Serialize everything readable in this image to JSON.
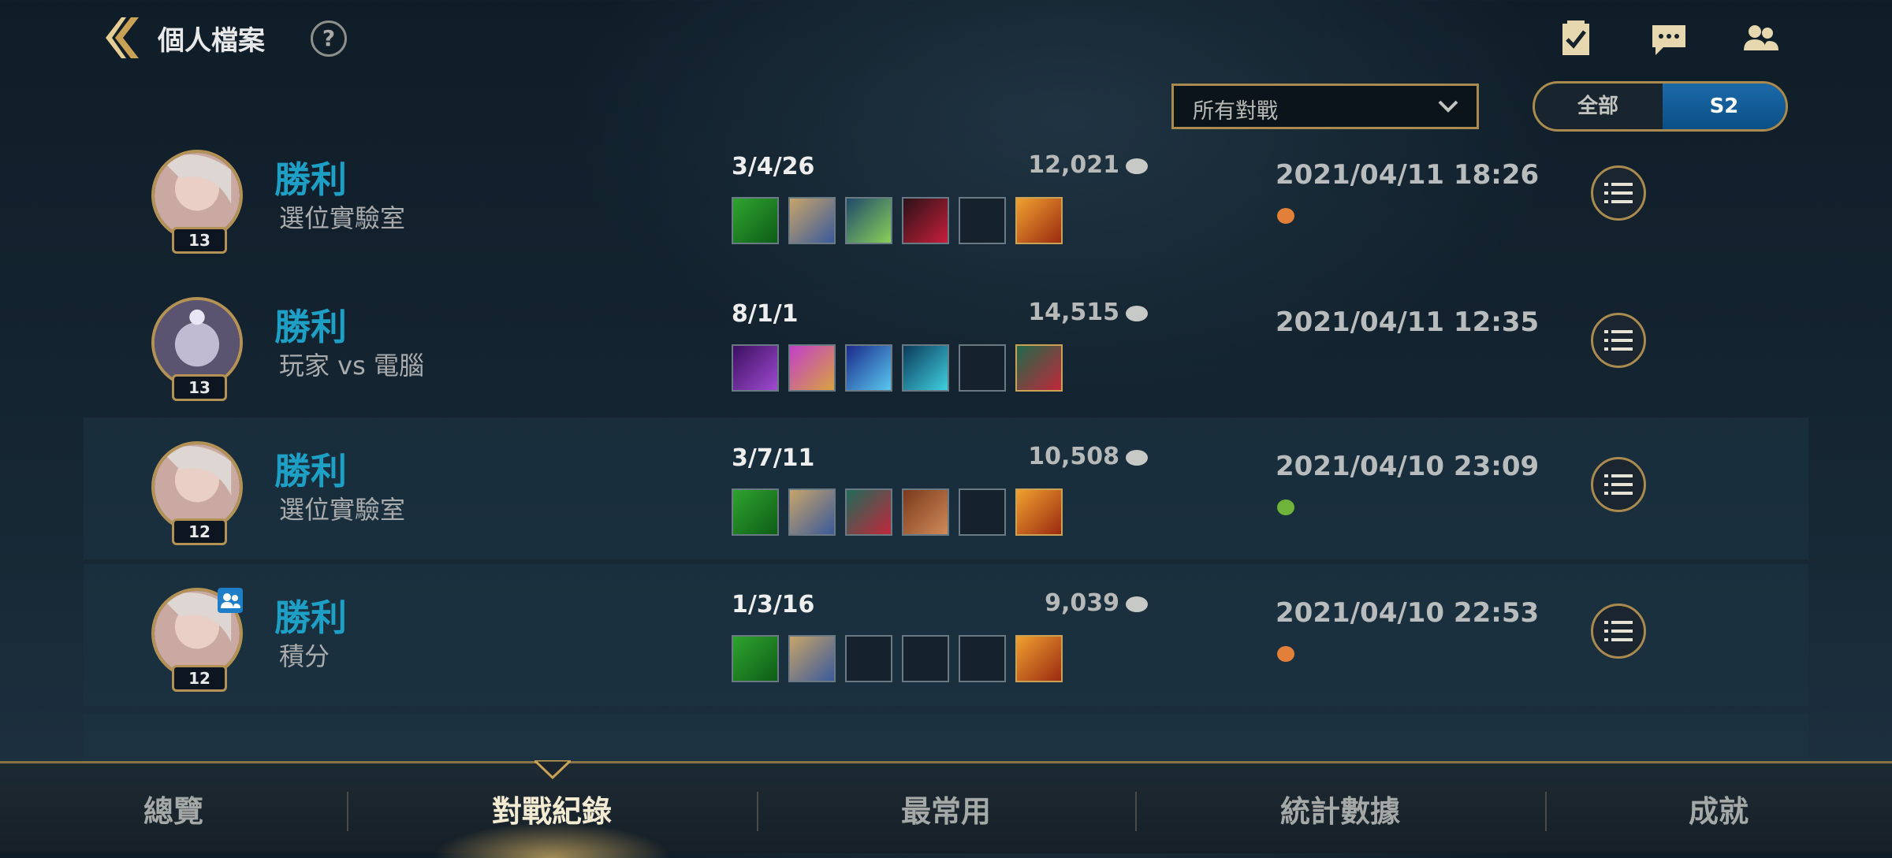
{
  "header": {
    "title": "個人檔案",
    "help_label": "?"
  },
  "filters": {
    "dropdown_value": "所有對戰",
    "season_options": [
      "全部",
      "S2"
    ],
    "season_selected": "S2"
  },
  "matches": [
    {
      "result": "勝利",
      "mode": "選位實驗室",
      "level": "13",
      "kda": "3/4/26",
      "gold": "12,021",
      "date": "2021/04/11 18:26",
      "party": false
    },
    {
      "result": "勝利",
      "mode": "玩家 vs 電腦",
      "level": "13",
      "kda": "8/1/1",
      "gold": "14,515",
      "date": "2021/04/11 12:35",
      "party": false
    },
    {
      "result": "勝利",
      "mode": "選位實驗室",
      "level": "12",
      "kda": "3/7/11",
      "gold": "10,508",
      "date": "2021/04/10 23:09",
      "party": false
    },
    {
      "result": "勝利",
      "mode": "積分",
      "level": "12",
      "kda": "1/3/16",
      "gold": "9,039",
      "date": "2021/04/10 22:53",
      "party": true
    }
  ],
  "tabs": [
    "總覽",
    "對戰紀錄",
    "最常用",
    "統計數據",
    "成就"
  ],
  "active_tab": "對戰紀錄",
  "colors": {
    "accent_gold": "#a98b4f",
    "victory_text": "#1ea0c6",
    "season_selected_bg": "#0b4f86"
  }
}
